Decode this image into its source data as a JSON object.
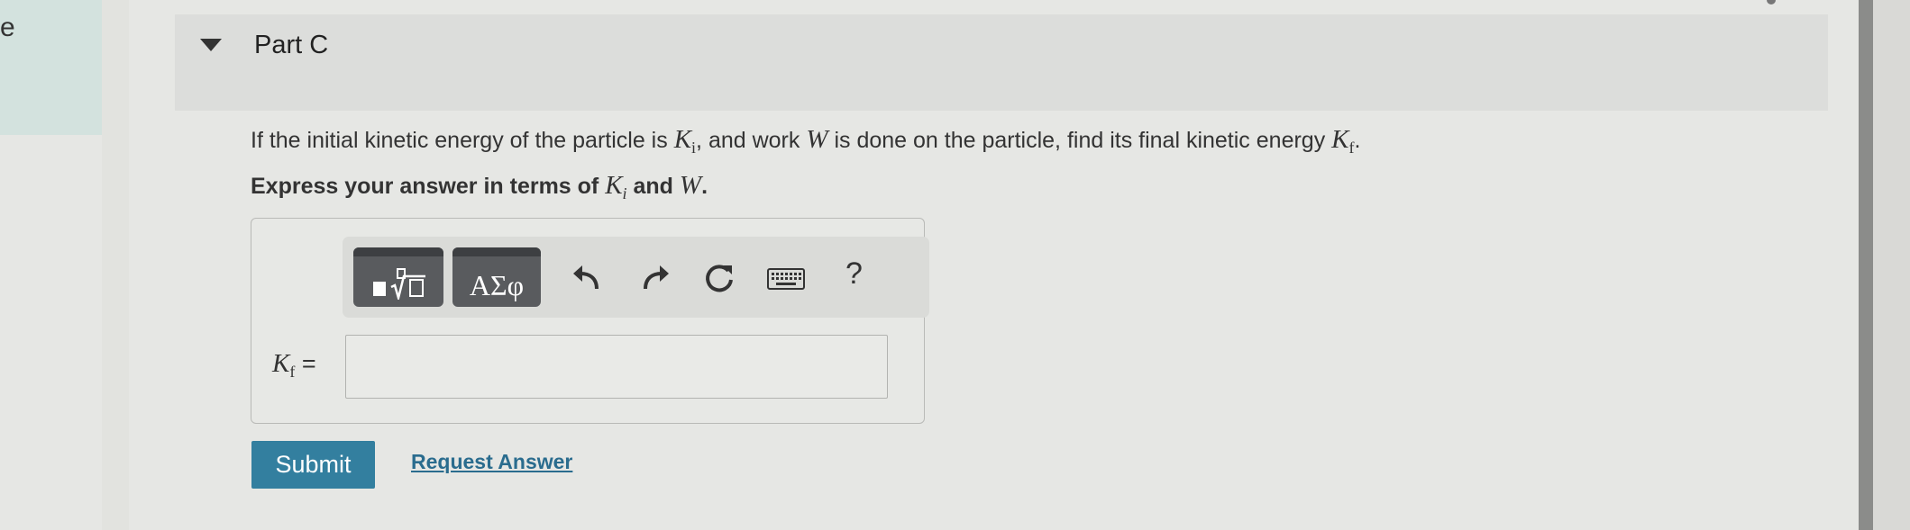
{
  "left_tab": {
    "text": "e"
  },
  "part": {
    "title": "Part C"
  },
  "question": {
    "text_1": "If the initial kinetic energy of the particle is ",
    "ki_var": "K",
    "ki_sub": "i",
    "text_2": ", and work ",
    "w_var": "W",
    "text_3": " is done on the particle, find its final kinetic energy ",
    "kf_var": "K",
    "kf_sub": "f",
    "text_4": "."
  },
  "instruction": {
    "text_1": "Express your answer in terms of ",
    "ki_var": "K",
    "ki_sub": "i",
    "text_2": " and ",
    "w_var": "W",
    "text_3": "."
  },
  "toolbar": {
    "templates_icon": "fraction-radical-template-icon",
    "greek_label": "ΑΣφ",
    "undo_icon": "undo-icon",
    "redo_icon": "redo-icon",
    "reset_icon": "reset-icon",
    "keyboard_icon": "keyboard-icon",
    "help_label": "?"
  },
  "answer": {
    "label_var": "K",
    "label_sub": "f",
    "label_eq": " =",
    "value": ""
  },
  "actions": {
    "submit_label": "Submit",
    "request_label": "Request Answer"
  },
  "colors": {
    "submit_bg": "#337f9f",
    "link": "#2a6c8e",
    "toolbar_button": "#595b5e"
  }
}
